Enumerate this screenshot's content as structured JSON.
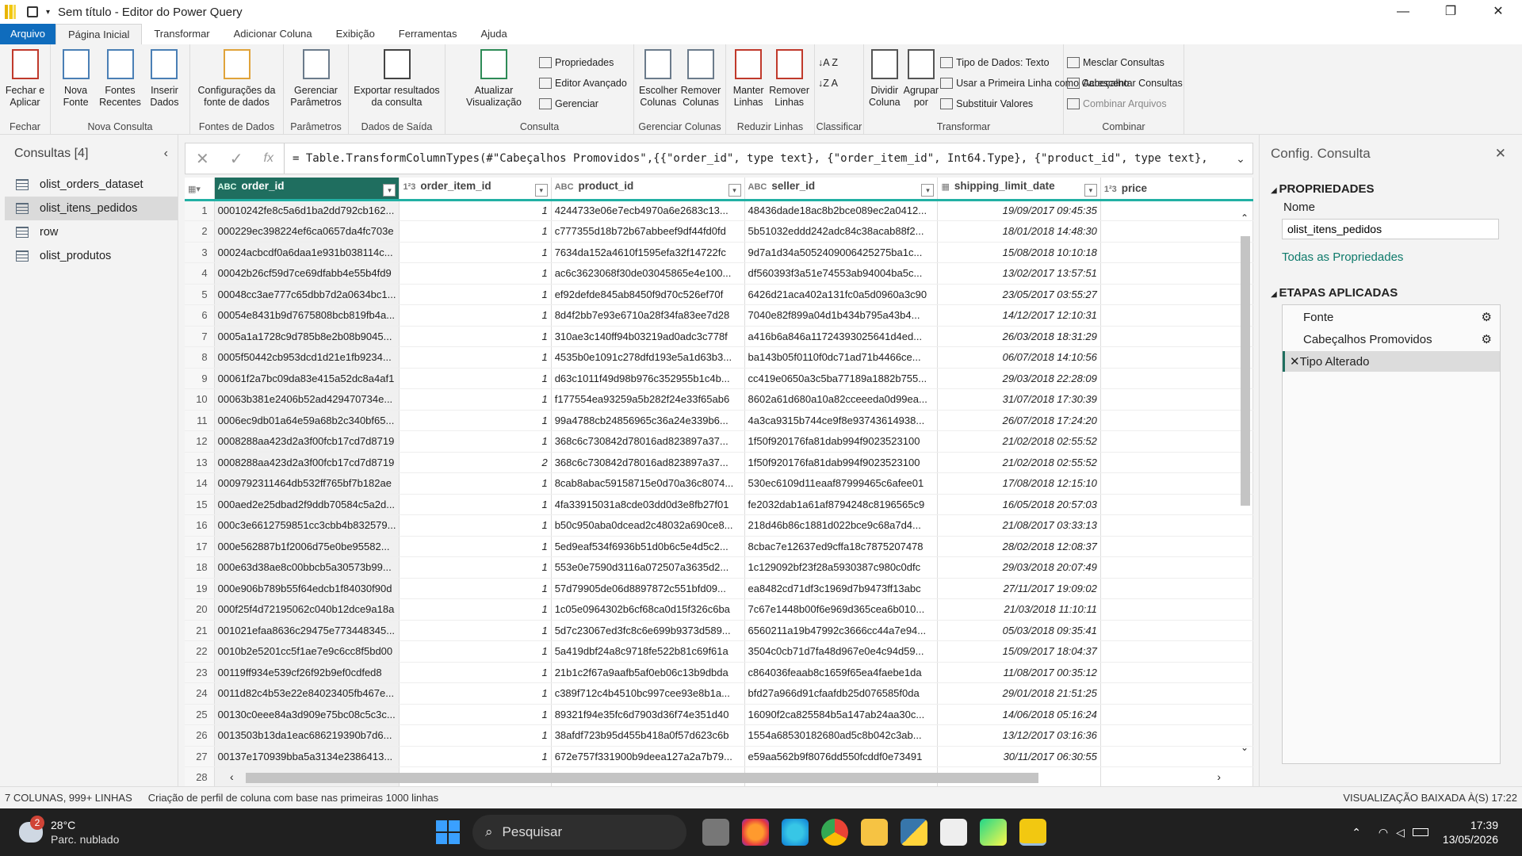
{
  "window": {
    "title": "Sem título - Editor do Power Query"
  },
  "menu_tabs": [
    "Arquivo",
    "Página Inicial",
    "Transformar",
    "Adicionar Coluna",
    "Exibição",
    "Ferramentas",
    "Ajuda"
  ],
  "ribbon": {
    "groups": [
      {
        "label": "Fechar",
        "items": [
          "Fechar e\nAplicar"
        ]
      },
      {
        "label": "Nova Consulta",
        "items": [
          "Nova\nFonte",
          "Fontes\nRecentes",
          "Inserir\nDados"
        ]
      },
      {
        "label": "Fontes de Dados",
        "items": [
          "Configurações da\nfonte de dados"
        ]
      },
      {
        "label": "Parâmetros",
        "items": [
          "Gerenciar\nParâmetros"
        ]
      },
      {
        "label": "Dados de Saída",
        "items": [
          "Exportar resultados\nda consulta"
        ]
      },
      {
        "label": "Consulta",
        "items": [
          "Atualizar\nVisualização"
        ],
        "small": [
          "Propriedades",
          "Editor Avançado",
          "Gerenciar"
        ]
      },
      {
        "label": "Gerenciar Colunas",
        "items": [
          "Escolher\nColunas",
          "Remover\nColunas"
        ]
      },
      {
        "label": "Reduzir Linhas",
        "items": [
          "Manter\nLinhas",
          "Remover\nLinhas"
        ]
      },
      {
        "label": "Classificar",
        "items": []
      },
      {
        "label": "Transformar",
        "items": [
          "Dividir\nColuna",
          "Agrupar\npor"
        ],
        "small": [
          "Tipo de Dados: Texto",
          "Usar a Primeira Linha como Cabeçalho",
          "Substituir Valores"
        ]
      },
      {
        "label": "Combinar",
        "small": [
          "Mesclar Consultas",
          "Acrescentar Consultas",
          "Combinar Arquivos"
        ]
      }
    ]
  },
  "formula": "= Table.TransformColumnTypes(#\"Cabeçalhos Promovidos\",{{\"order_id\", type text}, {\"order_item_id\", Int64.Type}, {\"product_id\", type text},",
  "queries": {
    "title": "Consultas [4]",
    "items": [
      "olist_orders_dataset",
      "olist_itens_pedidos",
      "row",
      "olist_produtos"
    ]
  },
  "columns": [
    {
      "type": "ABC",
      "name": "order_id"
    },
    {
      "type": "123",
      "name": "order_item_id"
    },
    {
      "type": "ABC",
      "name": "product_id"
    },
    {
      "type": "ABC",
      "name": "seller_id"
    },
    {
      "type": "date",
      "name": "shipping_limit_date"
    },
    {
      "type": "123",
      "name": "price"
    }
  ],
  "rows": [
    [
      "00010242fe8c5a6d1ba2dd792cb162...",
      "1",
      "4244733e06e7ecb4970a6e2683c13...",
      "48436dade18ac8b2bce089ec2a0412...",
      "19/09/2017 09:45:35"
    ],
    [
      "000229ec398224ef6ca0657da4fc703e",
      "1",
      "c777355d18b72b67abbeef9df44fd0fd",
      "5b51032eddd242adc84c38acab88f2...",
      "18/01/2018 14:48:30"
    ],
    [
      "00024acbcdf0a6daa1e931b038114c...",
      "1",
      "7634da152a4610f1595efa32f14722fc",
      "9d7a1d34a5052409006425275ba1c...",
      "15/08/2018 10:10:18"
    ],
    [
      "00042b26cf59d7ce69dfabb4e55b4fd9",
      "1",
      "ac6c3623068f30de03045865e4e100...",
      "df560393f3a51e74553ab94004ba5c...",
      "13/02/2017 13:57:51"
    ],
    [
      "00048cc3ae777c65dbb7d2a0634bc1...",
      "1",
      "ef92defde845ab8450f9d70c526ef70f",
      "6426d21aca402a131fc0a5d0960a3c90",
      "23/05/2017 03:55:27"
    ],
    [
      "00054e8431b9d7675808bcb819fb4a...",
      "1",
      "8d4f2bb7e93e6710a28f34fa83ee7d28",
      "7040e82f899a04d1b434b795a43b4...",
      "14/12/2017 12:10:31"
    ],
    [
      "0005a1a1728c9d785b8e2b08b9045...",
      "1",
      "310ae3c140ff94b03219ad0adc3c778f",
      "a416b6a846a11724393025641d4ed...",
      "26/03/2018 18:31:29"
    ],
    [
      "0005f50442cb953dcd1d21e1fb9234...",
      "1",
      "4535b0e1091c278dfd193e5a1d63b3...",
      "ba143b05f0110f0dc71ad71b4466ce...",
      "06/07/2018 14:10:56"
    ],
    [
      "00061f2a7bc09da83e415a52dc8a4af1",
      "1",
      "d63c1011f49d98b976c352955b1c4b...",
      "cc419e0650a3c5ba77189a1882b755...",
      "29/03/2018 22:28:09"
    ],
    [
      "00063b381e2406b52ad429470734e...",
      "1",
      "f177554ea93259a5b282f24e33f65ab6",
      "8602a61d680a10a82cceeeda0d99ea...",
      "31/07/2018 17:30:39"
    ],
    [
      "0006ec9db01a64e59a68b2c340bf65...",
      "1",
      "99a4788cb24856965c36a24e339b6...",
      "4a3ca9315b744ce9f8e93743614938...",
      "26/07/2018 17:24:20"
    ],
    [
      "0008288aa423d2a3f00fcb17cd7d8719",
      "1",
      "368c6c730842d78016ad823897a37...",
      "1f50f920176fa81dab994f9023523100",
      "21/02/2018 02:55:52"
    ],
    [
      "0008288aa423d2a3f00fcb17cd7d8719",
      "2",
      "368c6c730842d78016ad823897a37...",
      "1f50f920176fa81dab994f9023523100",
      "21/02/2018 02:55:52"
    ],
    [
      "0009792311464db532ff765bf7b182ae",
      "1",
      "8cab8abac59158715e0d70a36c8074...",
      "530ec6109d11eaaf87999465c6afee01",
      "17/08/2018 12:15:10"
    ],
    [
      "000aed2e25dbad2f9ddb70584c5a2d...",
      "1",
      "4fa33915031a8cde03dd0d3e8fb27f01",
      "fe2032dab1a61af8794248c8196565c9",
      "16/05/2018 20:57:03"
    ],
    [
      "000c3e6612759851cc3cbb4b832579...",
      "1",
      "b50c950aba0dcead2c48032a690ce8...",
      "218d46b86c1881d022bce9c68a7d4...",
      "21/08/2017 03:33:13"
    ],
    [
      "000e562887b1f2006d75e0be95582...",
      "1",
      "5ed9eaf534f6936b51d0b6c5e4d5c2...",
      "8cbac7e12637ed9cffa18c7875207478",
      "28/02/2018 12:08:37"
    ],
    [
      "000e63d38ae8c00bbcb5a30573b99...",
      "1",
      "553e0e7590d3116a072507a3635d2...",
      "1c129092bf23f28a5930387c980c0dfc",
      "29/03/2018 20:07:49"
    ],
    [
      "000e906b789b55f64edcb1f84030f90d",
      "1",
      "57d79905de06d8897872c551bfd09...",
      "ea8482cd71df3c1969d7b9473ff13abc",
      "27/11/2017 19:09:02"
    ],
    [
      "000f25f4d72195062c040b12dce9a18a",
      "1",
      "1c05e0964302b6cf68ca0d15f326c6ba",
      "7c67e1448b00f6e969d365cea6b010...",
      "21/03/2018 11:10:11"
    ],
    [
      "001021efaa8636c29475e773448345...",
      "1",
      "5d7c23067ed3fc8c6e699b9373d589...",
      "6560211a19b47992c3666cc44a7e94...",
      "05/03/2018 09:35:41"
    ],
    [
      "0010b2e5201cc5f1ae7e9c6cc8f5bd00",
      "1",
      "5a419dbf24a8c9718fe522b81c69f61a",
      "3504c0cb71d7fa48d967e0e4c94d59...",
      "15/09/2017 18:04:37"
    ],
    [
      "00119ff934e539cf26f92b9ef0cdfed8",
      "1",
      "21b1c2f67a9aafb5af0eb06c13b9dbda",
      "c864036feaab8c1659f65ea4faebe1da",
      "11/08/2017 00:35:12"
    ],
    [
      "0011d82c4b53e22e84023405fb467e...",
      "1",
      "c389f712c4b4510bc997cee93e8b1a...",
      "bfd27a966d91cfaafdb25d076585f0da",
      "29/01/2018 21:51:25"
    ],
    [
      "00130c0eee84a3d909e75bc08c5c3c...",
      "1",
      "89321f94e35fc6d7903d36f74e351d40",
      "16090f2ca825584b5a147ab24aa30c...",
      "14/06/2018 05:16:24"
    ],
    [
      "0013503b13da1eac686219390b7d6...",
      "1",
      "38afdf723b95d455b418a0f57d623c6b",
      "1554a68530182680ad5c8b042c3ab...",
      "13/12/2017 03:16:36"
    ],
    [
      "00137e170939bba5a3134e2386413...",
      "1",
      "672e757f331900b9deea127a2a7b79...",
      "e59aa562b9f8076dd550fcddf0e73491",
      "30/11/2017 06:30:55"
    ],
    [
      "",
      "",
      "",
      "",
      ""
    ]
  ],
  "config": {
    "title": "Config. Consulta",
    "properties_label": "PROPRIEDADES",
    "name_label": "Nome",
    "name_value": "olist_itens_pedidos",
    "all_props": "Todas as Propriedades",
    "steps_label": "ETAPAS APLICADAS",
    "steps": [
      "Fonte",
      "Cabeçalhos Promovidos",
      "Tipo Alterado"
    ]
  },
  "status": {
    "left": "7 COLUNAS, 999+ LINHAS",
    "profile": "Criação de perfil de coluna com base nas primeiras 1000 linhas",
    "right": "VISUALIZAÇÃO BAIXADA À(S) 17:22"
  },
  "taskbar": {
    "temp": "28°C",
    "weather": "Parc. nublado",
    "search": "Pesquisar",
    "time": "17:39",
    "date": "13/05/2026",
    "badge": "2"
  }
}
